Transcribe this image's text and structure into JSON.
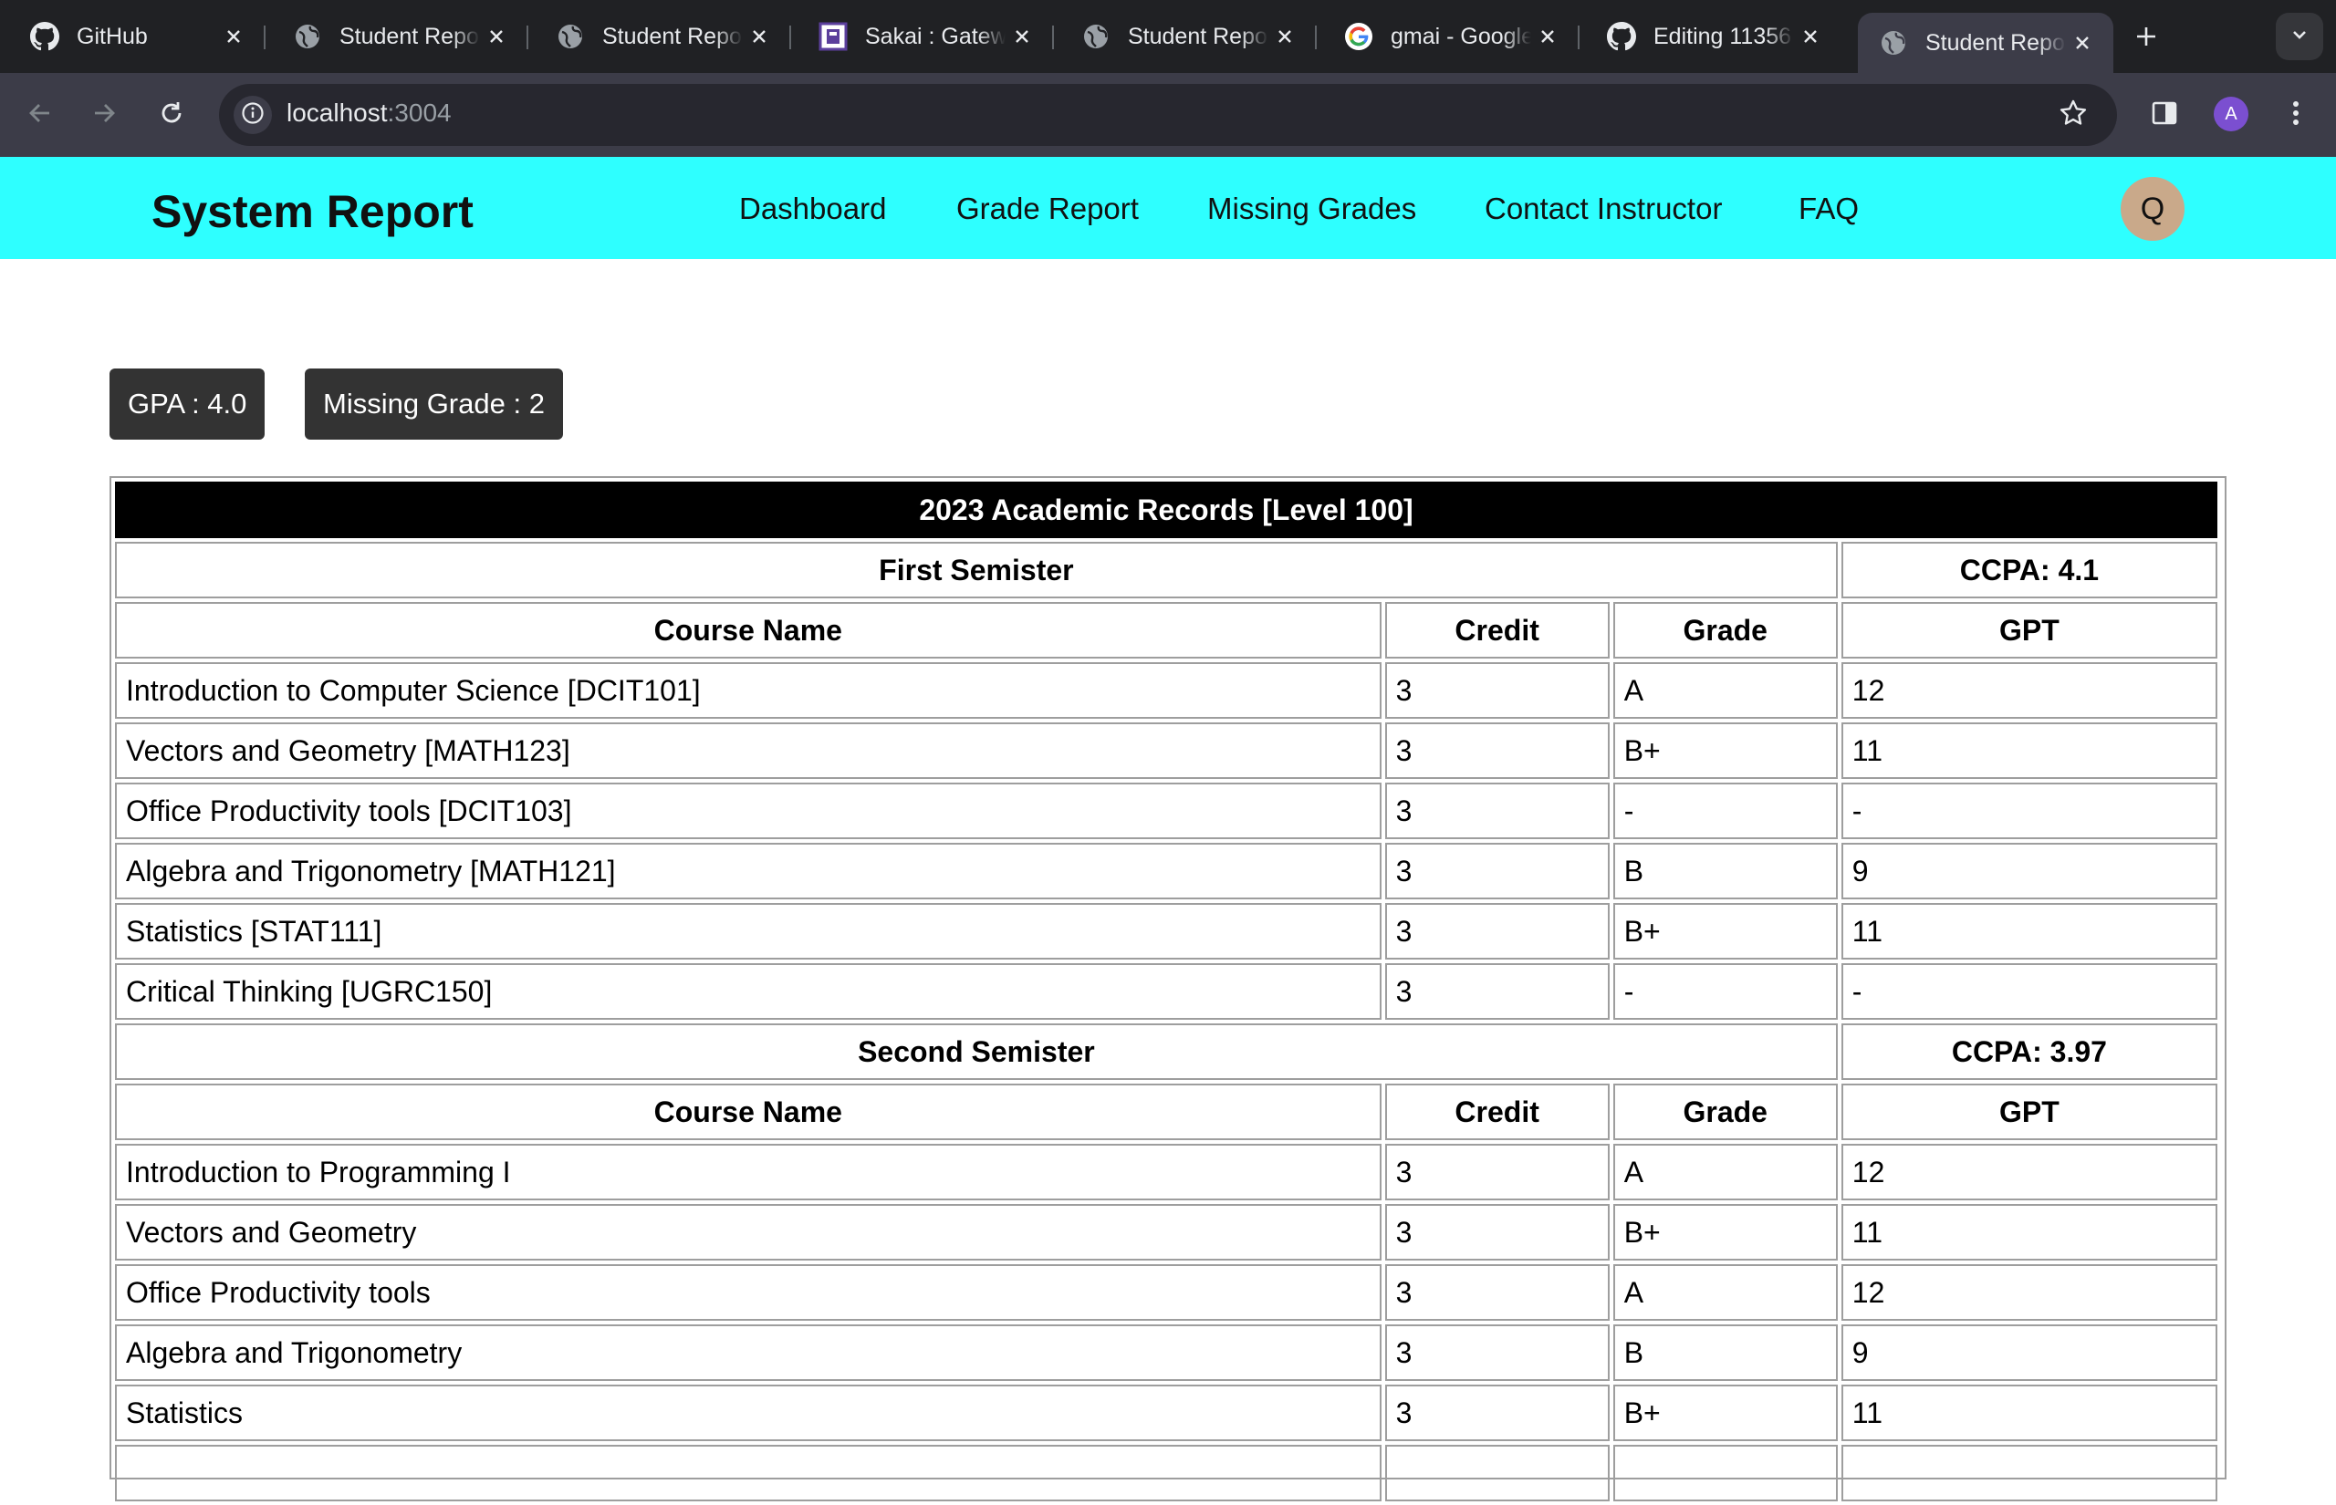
{
  "browser": {
    "tabs": [
      {
        "title": "GitHub",
        "icon": "github-icon",
        "active": false
      },
      {
        "title": "Student Report",
        "icon": "globe-icon",
        "active": false
      },
      {
        "title": "Student Report",
        "icon": "globe-icon",
        "active": false
      },
      {
        "title": "Sakai : Gateway",
        "icon": "sakai-icon",
        "active": false
      },
      {
        "title": "Student Report",
        "icon": "globe-icon",
        "active": false
      },
      {
        "title": "gmai - Google Search",
        "icon": "google-icon",
        "active": false
      },
      {
        "title": "Editing 11356",
        "icon": "github-icon",
        "active": false
      },
      {
        "title": "Student Report",
        "icon": "globe-icon",
        "active": true
      }
    ],
    "url_host": "localhost",
    "url_port": ":3004",
    "profile_initial": "A"
  },
  "app": {
    "brand": "System Report",
    "nav": [
      "Dashboard",
      "Grade Report",
      "Missing Grades",
      "Contact Instructor",
      "FAQ"
    ],
    "avatar_initial": "Q",
    "accent_color": "#2effff"
  },
  "stats": {
    "gpa": "GPA : 4.0",
    "missing": "Missing Grade : 2"
  },
  "records": {
    "title": "2023 Academic Records [Level 100]",
    "columns": [
      "Course Name",
      "Credit",
      "Grade",
      "GPT"
    ],
    "semesters": [
      {
        "name": "First Semister",
        "ccpa": "CCPA: 4.1",
        "courses": [
          {
            "name": "Introduction to Computer Science [DCIT101]",
            "credit": "3",
            "grade": "A",
            "gpt": "12"
          },
          {
            "name": "Vectors and Geometry [MATH123]",
            "credit": "3",
            "grade": "B+",
            "gpt": "11"
          },
          {
            "name": "Office Productivity tools [DCIT103]",
            "credit": "3",
            "grade": "-",
            "gpt": "-"
          },
          {
            "name": "Algebra and Trigonometry [MATH121]",
            "credit": "3",
            "grade": "B",
            "gpt": "9"
          },
          {
            "name": "Statistics [STAT111]",
            "credit": "3",
            "grade": "B+",
            "gpt": "11"
          },
          {
            "name": "Critical Thinking [UGRC150]",
            "credit": "3",
            "grade": "-",
            "gpt": "-"
          }
        ]
      },
      {
        "name": "Second Semister",
        "ccpa": "CCPA: 3.97",
        "courses": [
          {
            "name": "Introduction to Programming I",
            "credit": "3",
            "grade": "A",
            "gpt": "12"
          },
          {
            "name": "Vectors and Geometry",
            "credit": "3",
            "grade": "B+",
            "gpt": "11"
          },
          {
            "name": "Office Productivity tools",
            "credit": "3",
            "grade": "A",
            "gpt": "12"
          },
          {
            "name": "Algebra and Trigonometry",
            "credit": "3",
            "grade": "B",
            "gpt": "9"
          },
          {
            "name": "Statistics",
            "credit": "3",
            "grade": "B+",
            "gpt": "11"
          }
        ]
      }
    ]
  }
}
